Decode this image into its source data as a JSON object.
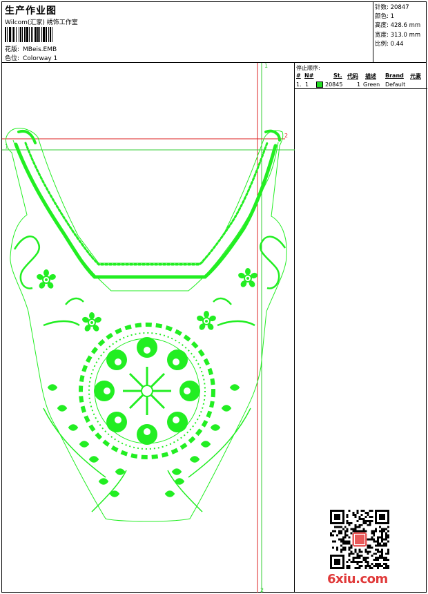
{
  "header": {
    "title": "生产作业图",
    "company": "Wilcom(汇家) 绣饰工作室",
    "design_label": "花版:",
    "design_value": "MBeis.EMB",
    "color_label": "色位:",
    "color_value": "Colorway 1"
  },
  "stats": [
    {
      "label": "针数:",
      "value": "20847"
    },
    {
      "label": "颜色:",
      "value": "1"
    },
    {
      "label": "高度:",
      "value": "428.6 mm"
    },
    {
      "label": "宽度:",
      "value": "313.0 mm"
    },
    {
      "label": "比例:",
      "value": "0.44"
    }
  ],
  "guides": {
    "top_left": "1",
    "top_right": "1",
    "red_right": "2",
    "bottom": "2"
  },
  "stop_sequence": {
    "title": "停止顺序:",
    "columns": [
      "#",
      "N#",
      "St.",
      "代码",
      "描述",
      "Brand",
      "元素"
    ],
    "rows": [
      {
        "index": "1.",
        "number": "1",
        "stitches": "20845",
        "code": "1",
        "description": "Green",
        "brand": "Default",
        "color": "#22dd22"
      }
    ]
  },
  "watermark": "6xiu.com",
  "colors": {
    "thread": "#22ee22",
    "guide_green": "#33cc33",
    "guide_red": "#dd2222"
  }
}
